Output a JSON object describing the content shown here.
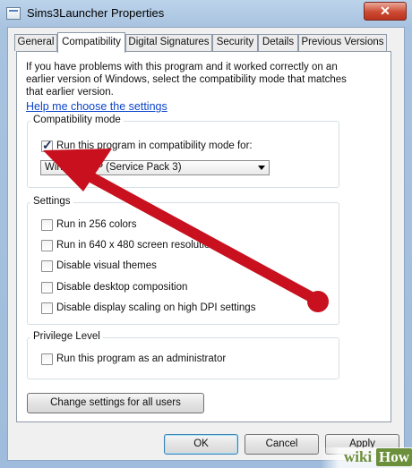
{
  "window": {
    "title": "Sims3Launcher Properties",
    "close_label": "✕"
  },
  "tabs": [
    {
      "label": "General"
    },
    {
      "label": "Compatibility"
    },
    {
      "label": "Digital Signatures"
    },
    {
      "label": "Security"
    },
    {
      "label": "Details"
    },
    {
      "label": "Previous Versions"
    }
  ],
  "active_tab": "Compatibility",
  "intro": {
    "line1": "If you have problems with this program and it worked correctly on an",
    "line2": "earlier version of Windows, select the compatibility mode that matches",
    "line3": "that earlier version."
  },
  "help_link": "Help me choose the settings",
  "compat_mode": {
    "label": "Compatibility mode",
    "checkbox_label": "Run this program in compatibility mode for:",
    "checked": true,
    "dropdown_value": "Windows XP (Service Pack 3)"
  },
  "settings": {
    "label": "Settings",
    "items": [
      {
        "label": "Run in 256 colors",
        "checked": false
      },
      {
        "label": "Run in 640 x 480 screen resolution",
        "checked": false
      },
      {
        "label": "Disable visual themes",
        "checked": false
      },
      {
        "label": "Disable desktop composition",
        "checked": false
      },
      {
        "label": "Disable display scaling on high DPI settings",
        "checked": false
      }
    ]
  },
  "privilege": {
    "label": "Privilege Level",
    "checkbox_label": "Run this program as an administrator",
    "checked": false
  },
  "change_all_users_button": "Change settings for all users",
  "buttons": {
    "ok": "OK",
    "cancel": "Cancel",
    "apply": "Apply"
  },
  "annotation": {
    "arrow_color": "#c8101e"
  },
  "watermark": {
    "wiki": "wiki",
    "how": "How"
  }
}
